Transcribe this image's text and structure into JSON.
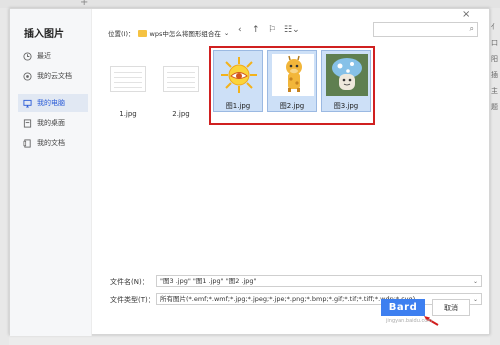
{
  "dialog": {
    "title": "插入图片",
    "close_glyph": "×"
  },
  "sidebar": {
    "items": [
      {
        "label": "最近",
        "icon": "clock-icon"
      },
      {
        "label": "我的云文档",
        "icon": "cloud-icon"
      },
      {
        "label": "我的电脑",
        "icon": "computer-icon",
        "active": true
      },
      {
        "label": "我的桌面",
        "icon": "desktop-icon"
      },
      {
        "label": "我的文档",
        "icon": "document-icon"
      }
    ]
  },
  "pathbar": {
    "label": "位置(I)：",
    "folder": "wps中怎么将图形组合在",
    "dropdown": "⌄",
    "back": "‹",
    "up": "↑",
    "new_folder": "⚐",
    "view": "☷⌄"
  },
  "search": {
    "icon_glyph": "⌕"
  },
  "files": [
    {
      "name": "1.jpg",
      "selected": false
    },
    {
      "name": "2.jpg",
      "selected": false
    },
    {
      "name": "图1.jpg",
      "selected": true
    },
    {
      "name": "图2.jpg",
      "selected": true
    },
    {
      "name": "图3.jpg",
      "selected": true
    }
  ],
  "filename": {
    "label": "文件名(N)：",
    "value": "\"图3 .jpg\" \"图1 .jpg\" \"图2 .jpg\""
  },
  "filetype": {
    "label": "文件类型(T)：",
    "value": "所有图片(*.emf;*.wmf;*.jpg;*.jpeg;*.jpe;*.png;*.bmp;*.gif;*.tif;*.tiff;*.wdp;*.svg)"
  },
  "buttons": {
    "open": "Bard",
    "cancel": "取消"
  },
  "watermark": "jingyan.baidu.com",
  "background": {
    "plus": "+",
    "right_items": [
      "亻",
      "口",
      "阳",
      "插",
      "主",
      "题"
    ]
  },
  "colors": {
    "accent": "#3d7ff0",
    "selection": "#cde0f7",
    "highlight_border": "#d02020"
  }
}
